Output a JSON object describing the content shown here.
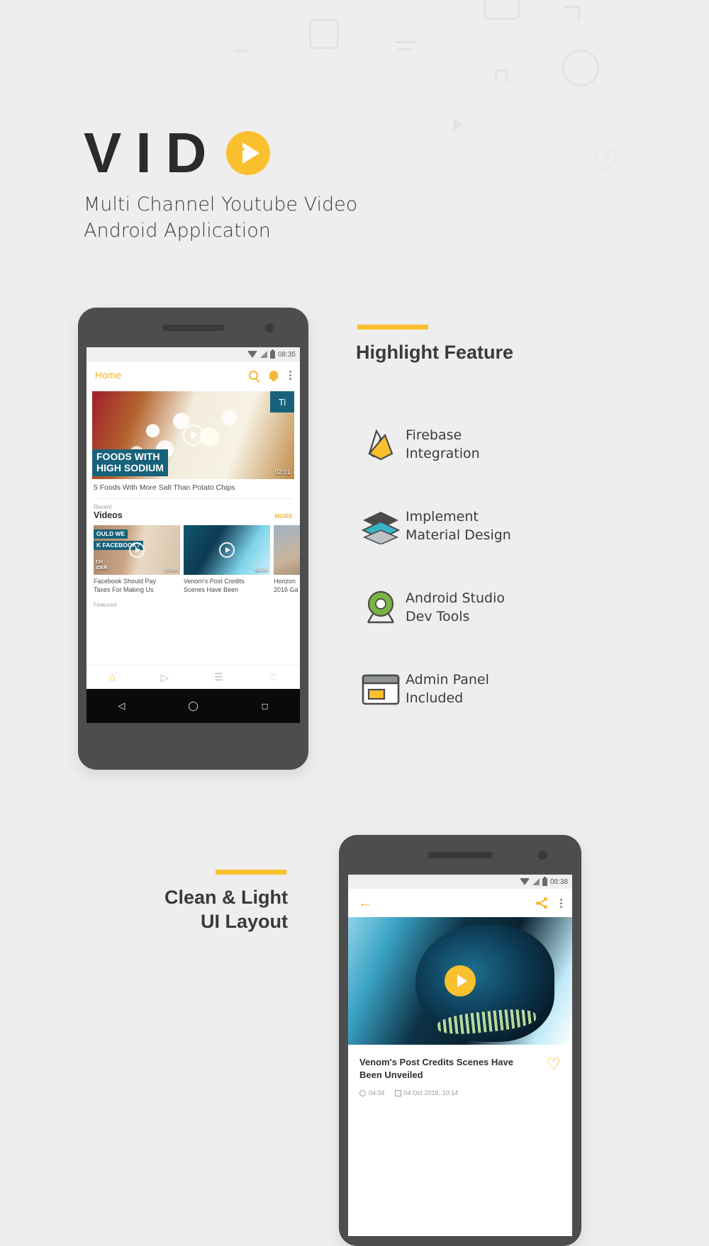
{
  "brand": {
    "logo_text": "VID",
    "logo_icon": "play-circle-icon",
    "tagline_line1": "Multi Channel Youtube Video",
    "tagline_line2": "Android Application",
    "accent_color": "#fbc02d",
    "teal_color": "#17627a",
    "background_color": "#eeeeee"
  },
  "phone1": {
    "status_bar": {
      "time": "08:35",
      "icons": [
        "wifi-icon",
        "signal-icon",
        "battery-icon"
      ]
    },
    "app_bar": {
      "title": "Home",
      "search_icon": "search-icon",
      "notification_icon": "bell-icon",
      "overflow_icon": "more-vertical-icon"
    },
    "hero": {
      "badge_label": "Ti",
      "overlay_line1": "FOODS WITH",
      "overlay_line2": "HIGH SODIUM",
      "duration": "02:01",
      "title": "5 Foods With More Salt Than Potato Chips",
      "play_icon": "play-outline-icon"
    },
    "recent_section": {
      "eyebrow": "Recent",
      "title": "Videos",
      "more_label": "MORE"
    },
    "thumbnails": [
      {
        "tag_line1": "OULD WE",
        "tag_line2": "K FACEBOOK?",
        "corner_line1": "CH",
        "corner_line2": "IDER",
        "duration": "03:46",
        "caption_line1": "Facebook Should Pay",
        "caption_line2": "Taxes For Making Us"
      },
      {
        "tag_line1": "",
        "tag_line2": "",
        "corner_line1": "",
        "corner_line2": "",
        "duration": "04:34",
        "caption_line1": "Venom's Post Credits",
        "caption_line2": "Scenes Have Been"
      },
      {
        "tag_line1": "",
        "tag_line2": "",
        "corner_line1": "",
        "corner_line2": "",
        "duration": "",
        "caption_line1": "Horizon",
        "caption_line2": "2016 Ga"
      }
    ],
    "featured_label": "Featured",
    "tab_bar": [
      {
        "icon": "home-icon",
        "active": true
      },
      {
        "icon": "play-circle-icon",
        "active": false
      },
      {
        "icon": "playlist-icon",
        "active": false
      },
      {
        "icon": "heart-icon",
        "active": false
      }
    ],
    "nav_bar": {
      "back_icon": "triangle-back-icon",
      "home_icon": "circle-home-icon",
      "recents_icon": "square-recents-icon"
    }
  },
  "highlight": {
    "title": "Highlight Feature",
    "features": [
      {
        "icon": "firebase-icon",
        "line1": "Firebase",
        "line2": "Integration"
      },
      {
        "icon": "material-layers-icon",
        "line1": "Implement",
        "line2": "Material Design"
      },
      {
        "icon": "android-studio-icon",
        "line1": "Android Studio",
        "line2": "Dev Tools"
      },
      {
        "icon": "admin-panel-icon",
        "line1": "Admin Panel",
        "line2": "Included"
      }
    ]
  },
  "clean_light": {
    "title_line1": "Clean & Light",
    "title_line2": "UI Layout"
  },
  "phone2": {
    "status_bar": {
      "time": "08:38",
      "icons": [
        "wifi-icon",
        "signal-icon",
        "battery-icon"
      ]
    },
    "app_bar": {
      "back_icon": "arrow-back-icon",
      "share_icon": "share-icon",
      "overflow_icon": "more-vertical-icon"
    },
    "video": {
      "play_icon": "play-filled-icon",
      "title_line1": "Venom's Post Credits Scenes Have",
      "title_line2": "Been Unveiled",
      "favorite_icon": "heart-outline-icon",
      "duration": "04:34",
      "published": "04 Oct 2018, 10:14",
      "duration_icon": "clock-icon",
      "date_icon": "calendar-icon"
    }
  }
}
